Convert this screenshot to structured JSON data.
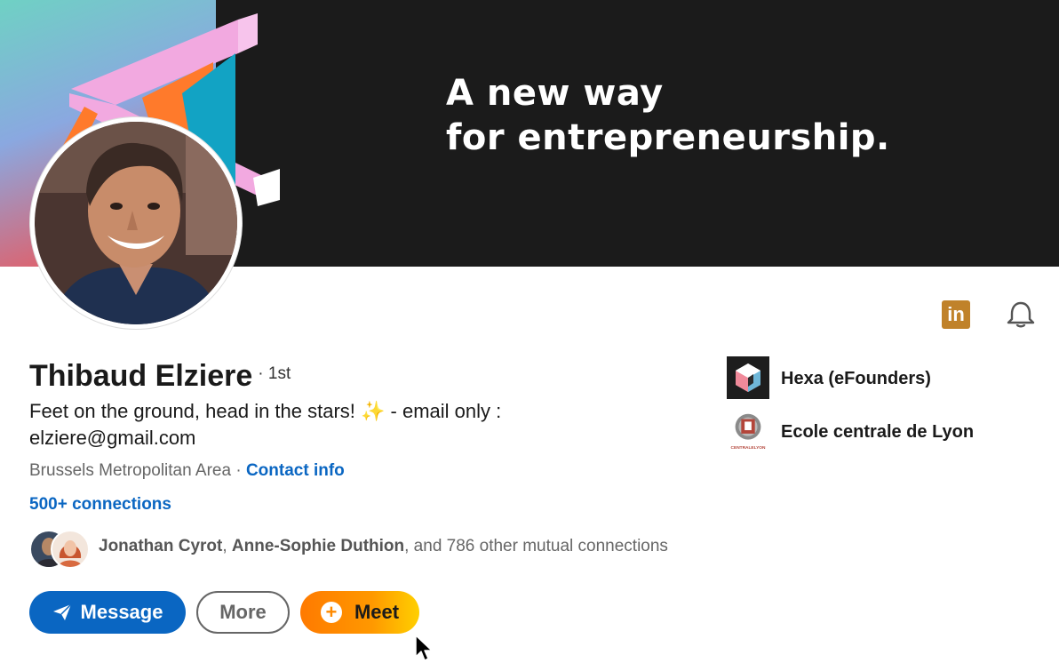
{
  "banner": {
    "tagline_line1": "A new way",
    "tagline_line2": "for entrepreneurship."
  },
  "profile": {
    "name": "Thibaud Elziere",
    "degree": "· 1st",
    "headline_line1": "Feet on the ground, head in the stars! ✨ - email only :",
    "headline_line2": "elziere@gmail.com",
    "location": "Brussels Metropolitan Area",
    "separator": "·",
    "contact_info": "Contact info",
    "connections": "500+ connections"
  },
  "mutual": {
    "name1": "Jonathan Cyrot",
    "comma": ",",
    "name2": "Anne-Sophie Duthion",
    "rest": ", and 786 other mutual connections"
  },
  "actions": {
    "message": "Message",
    "more": "More",
    "meet": "Meet"
  },
  "organizations": [
    {
      "name": "Hexa (eFounders)"
    },
    {
      "name": "Ecole centrale de Lyon",
      "logo_text": "CENTRALELYON"
    }
  ],
  "icons": {
    "linkedin": "in",
    "bell": "bell-icon",
    "send": "send-icon",
    "plus": "+"
  },
  "colors": {
    "brand_blue": "#0a66c2",
    "meet_orange": "#ff8a00",
    "linkedin_icon": "#c0822a",
    "banner_bg": "#1b1b1b"
  }
}
